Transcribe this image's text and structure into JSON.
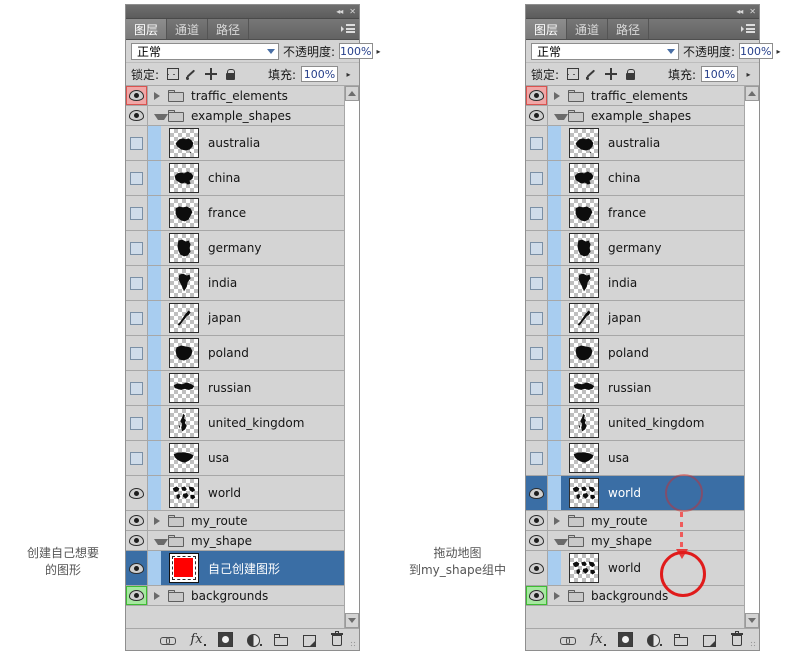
{
  "window": {
    "collapse_label": "◂◂",
    "close_label": "✕"
  },
  "tabs": [
    {
      "label": "图层",
      "active": true
    },
    {
      "label": "通道",
      "active": false
    },
    {
      "label": "路径",
      "active": false
    }
  ],
  "controls": {
    "blend_mode": "正常",
    "opacity_label": "不透明度:",
    "opacity_value": "100%",
    "lock_label": "锁定:",
    "fill_label": "填充:",
    "fill_value": "100%",
    "lock_icons": [
      "lock-transparent-pixels-icon",
      "lock-image-pixels-icon",
      "lock-position-icon",
      "lock-all-icon"
    ]
  },
  "layers": [
    {
      "name": "traffic_elements",
      "type": "group",
      "expanded": false,
      "visible": true,
      "eye_highlight": "red",
      "indent": 0,
      "selected": false
    },
    {
      "name": "example_shapes",
      "type": "group",
      "expanded": true,
      "visible": true,
      "eye_highlight": "none",
      "indent": 0,
      "selected": false
    },
    {
      "name": "australia",
      "type": "layer",
      "shape": "australia",
      "visible": false,
      "indent": 1,
      "selected": false
    },
    {
      "name": "china",
      "type": "layer",
      "shape": "china",
      "visible": false,
      "indent": 1,
      "selected": false
    },
    {
      "name": "france",
      "type": "layer",
      "shape": "france",
      "visible": false,
      "indent": 1,
      "selected": false
    },
    {
      "name": "germany",
      "type": "layer",
      "shape": "germany",
      "visible": false,
      "indent": 1,
      "selected": false
    },
    {
      "name": "india",
      "type": "layer",
      "shape": "india",
      "visible": false,
      "indent": 1,
      "selected": false
    },
    {
      "name": "japan",
      "type": "layer",
      "shape": "japan",
      "visible": false,
      "indent": 1,
      "selected": false
    },
    {
      "name": "poland",
      "type": "layer",
      "shape": "poland",
      "visible": false,
      "indent": 1,
      "selected": false
    },
    {
      "name": "russian",
      "type": "layer",
      "shape": "russian",
      "visible": false,
      "indent": 1,
      "selected": false
    },
    {
      "name": "united_kingdom",
      "type": "layer",
      "shape": "united_kingdom",
      "visible": false,
      "indent": 1,
      "selected": false
    },
    {
      "name": "usa",
      "type": "layer",
      "shape": "usa",
      "visible": false,
      "indent": 1,
      "selected": false
    },
    {
      "name": "world",
      "type": "layer",
      "shape": "world",
      "visible": true,
      "indent": 1,
      "selected": false
    },
    {
      "name": "my_route",
      "type": "group",
      "expanded": false,
      "visible": true,
      "eye_highlight": "none",
      "indent": 0,
      "selected": false
    },
    {
      "name": "my_shape",
      "type": "group",
      "expanded": true,
      "visible": true,
      "eye_highlight": "none",
      "indent": 0,
      "selected": false
    },
    {
      "name": "自己创建图形",
      "type": "layer",
      "shape": "red_square",
      "visible": true,
      "indent": 1,
      "selected": true
    },
    {
      "name": "backgrounds",
      "type": "group",
      "expanded": false,
      "visible": true,
      "eye_highlight": "green",
      "indent": 0,
      "selected": false
    }
  ],
  "layers_right": [
    {
      "name": "traffic_elements",
      "type": "group",
      "expanded": false,
      "visible": true,
      "eye_highlight": "red",
      "indent": 0,
      "selected": false
    },
    {
      "name": "example_shapes",
      "type": "group",
      "expanded": true,
      "visible": true,
      "eye_highlight": "none",
      "indent": 0,
      "selected": false
    },
    {
      "name": "australia",
      "type": "layer",
      "shape": "australia",
      "visible": false,
      "indent": 1,
      "selected": false
    },
    {
      "name": "china",
      "type": "layer",
      "shape": "china",
      "visible": false,
      "indent": 1,
      "selected": false
    },
    {
      "name": "france",
      "type": "layer",
      "shape": "france",
      "visible": false,
      "indent": 1,
      "selected": false
    },
    {
      "name": "germany",
      "type": "layer",
      "shape": "germany",
      "visible": false,
      "indent": 1,
      "selected": false
    },
    {
      "name": "india",
      "type": "layer",
      "shape": "india",
      "visible": false,
      "indent": 1,
      "selected": false
    },
    {
      "name": "japan",
      "type": "layer",
      "shape": "japan",
      "visible": false,
      "indent": 1,
      "selected": false
    },
    {
      "name": "poland",
      "type": "layer",
      "shape": "poland",
      "visible": false,
      "indent": 1,
      "selected": false
    },
    {
      "name": "russian",
      "type": "layer",
      "shape": "russian",
      "visible": false,
      "indent": 1,
      "selected": false
    },
    {
      "name": "united_kingdom",
      "type": "layer",
      "shape": "united_kingdom",
      "visible": false,
      "indent": 1,
      "selected": false
    },
    {
      "name": "usa",
      "type": "layer",
      "shape": "usa",
      "visible": false,
      "indent": 1,
      "selected": false
    },
    {
      "name": "world",
      "type": "layer",
      "shape": "world",
      "visible": true,
      "indent": 1,
      "selected": true
    },
    {
      "name": "my_route",
      "type": "group",
      "expanded": false,
      "visible": true,
      "eye_highlight": "none",
      "indent": 0,
      "selected": false
    },
    {
      "name": "my_shape",
      "type": "group",
      "expanded": true,
      "visible": true,
      "eye_highlight": "none",
      "indent": 0,
      "selected": false
    },
    {
      "name": "world",
      "type": "layer",
      "shape": "world",
      "visible": true,
      "indent": 1,
      "selected": false,
      "row_highlight": true
    },
    {
      "name": "backgrounds",
      "type": "group",
      "expanded": false,
      "visible": true,
      "eye_highlight": "green",
      "indent": 0,
      "selected": false
    }
  ],
  "bottom_toolbar": [
    "link-layers-icon",
    "layer-style-fx-icon",
    "add-layer-mask-icon",
    "adjustment-layer-icon",
    "new-group-icon",
    "new-layer-icon",
    "delete-layer-icon"
  ],
  "annotations": {
    "left": "创建自己想要\n的图形",
    "middle": "拖动地图\n到my_shape组中"
  },
  "colors": {
    "selection_blue": "#3a6ea5",
    "indent_rail": "#a8cdf0",
    "panel_bg": "#d4d4d4",
    "annotation_red": "#e01b1b",
    "eye_highlight_red": "#f0a7a7",
    "eye_highlight_green": "#a6e8a0",
    "red_thumbnail": "#ff0000"
  }
}
